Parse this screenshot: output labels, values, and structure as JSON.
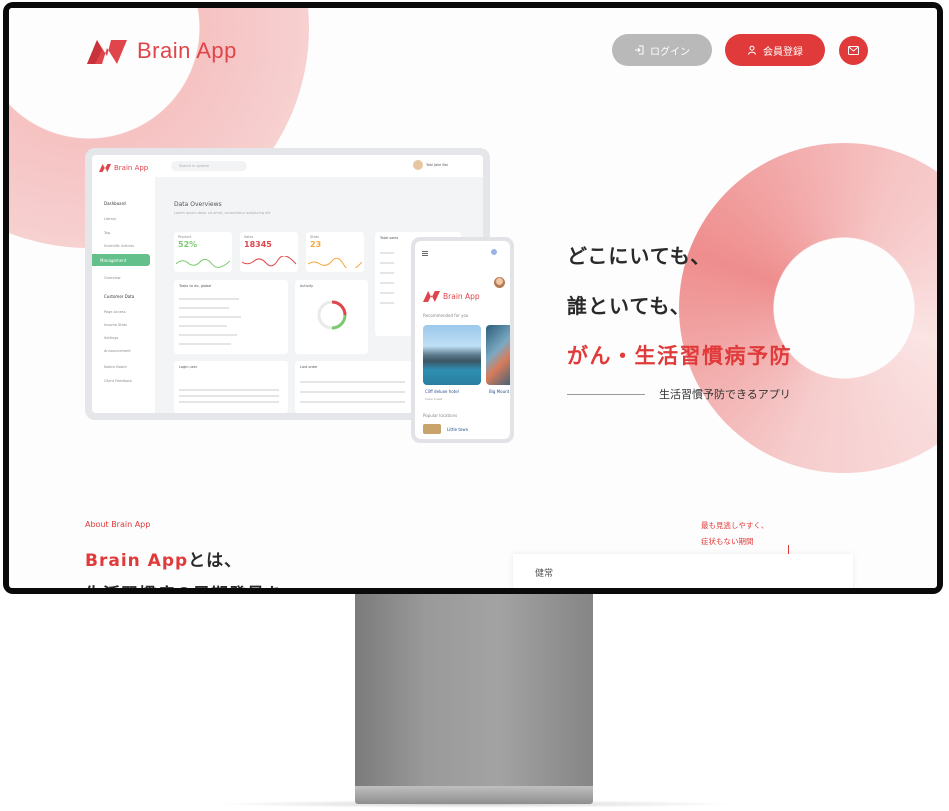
{
  "app": {
    "name": "Brain App",
    "brand_color": "#e03a3a"
  },
  "header": {
    "login_label": "ログイン",
    "register_label": "会員登録"
  },
  "hero": {
    "line1": "どこにいても、",
    "line2": "誰といても、",
    "accent": "がん・生活習慣病予防",
    "sub": "生活習慣予防できるアプリ"
  },
  "about": {
    "label": "About Brain App",
    "title_app": "Brain App",
    "title_rest": "とは、",
    "title_line2": "生活習慣病の早期発見を",
    "note_line1": "最も見逃しやすく、",
    "note_line2": "症状もない期間",
    "chart_label": "健常"
  },
  "dashboard": {
    "brand": "Brain App",
    "search_placeholder": "Search in system",
    "user_name": "Tobi Jake Bai",
    "heading": "Data Overviews",
    "subheading": "Lorem ipsum dolor sit amet, consectetur adipiscing elit",
    "sidebar": {
      "section1": "Dashboard",
      "items1": [
        "Library",
        "Tag",
        "Scientific Articles"
      ],
      "active": "Management",
      "items1b": [
        "Overview"
      ],
      "section2": "Customer Data",
      "items2": [
        "Page Access",
        "Income Stats",
        "Settings",
        "Announcement",
        "Notice Board",
        "Client Feedback"
      ]
    },
    "stats": [
      {
        "title": "Product",
        "value": "52%",
        "color": "#7bc96f"
      },
      {
        "title": "Sales",
        "value": "18345",
        "color": "#e0454b"
      },
      {
        "title": "Stats",
        "value": "23",
        "color": "#f4a83a"
      }
    ],
    "panels": {
      "tasks": "Tasks to do, global",
      "activity": "Activity",
      "users": "Login user",
      "last_order": "Last order",
      "total": "Total sales"
    }
  },
  "phone": {
    "brand": "Brain App",
    "recommended": "Recommended for you",
    "card1": "Cliff deluxe hotel",
    "card2": "Big Mount",
    "location": "Cape Coast",
    "popular": "Popular locations",
    "item1": "Little town"
  }
}
